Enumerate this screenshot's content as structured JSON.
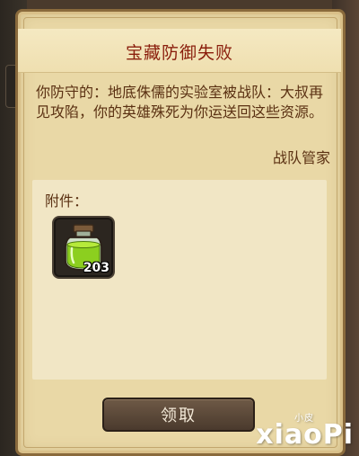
{
  "mail": {
    "title": "宝藏防御失败",
    "body": "你防守的：地底侏儒的实验室被战队：大叔再见攻陷，你的英雄殊死为你运送回这些资源。",
    "sender": "战队管家"
  },
  "attachments": {
    "label": "附件：",
    "items": [
      {
        "icon": "green-potion-jar-icon",
        "count": "203"
      }
    ]
  },
  "actions": {
    "claim_label": "领取"
  },
  "watermark": {
    "text": "xiaoPi",
    "small": "小皮"
  },
  "colors": {
    "title": "#8a1e0c",
    "text": "#5a3012",
    "parchment": "#e9d8a6"
  }
}
